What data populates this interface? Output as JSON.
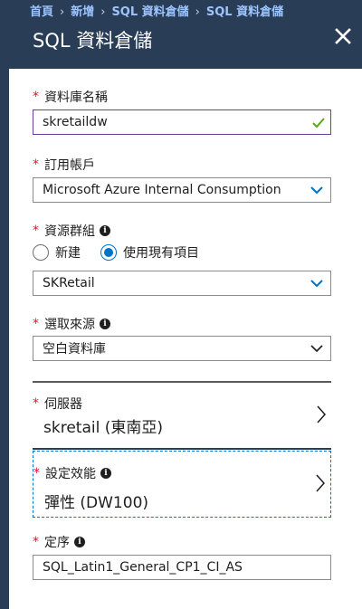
{
  "breadcrumb": [
    "首頁",
    "新增",
    "SQL 資料倉儲",
    "SQL 資料倉儲"
  ],
  "blade": {
    "title": "SQL 資料倉儲"
  },
  "form": {
    "db_name": {
      "label": "資料庫名稱",
      "value": "skretaildw"
    },
    "subscription": {
      "label": "訂用帳戶",
      "value": "Microsoft Azure Internal Consumption"
    },
    "resource_group": {
      "label": "資源群組",
      "options": [
        "新建",
        "使用現有項目"
      ],
      "selected": "使用現有項目",
      "value": "SKRetail"
    },
    "source": {
      "label": "選取來源",
      "value": "空白資料庫"
    },
    "server": {
      "label": "伺服器",
      "value": "skretail (東南亞)"
    },
    "performance": {
      "label": "設定效能",
      "value": "彈性 (DW100)"
    },
    "collation": {
      "label": "定序",
      "value": "SQL_Latin1_General_CP1_CI_AS"
    }
  },
  "colors": {
    "header": "#2a3d57",
    "accent": "#0072c6",
    "required": "#e81123",
    "valid": "#5ba71b"
  }
}
